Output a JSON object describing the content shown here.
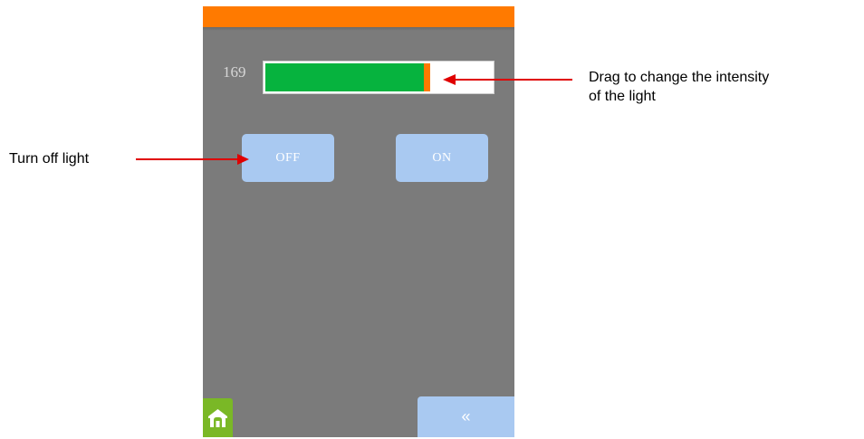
{
  "screen": {
    "colors": {
      "topbar": "#ff7a00",
      "background": "#7b7b7b",
      "slider_fill": "#06b33e",
      "slider_thumb": "#ff7a00",
      "button": "#a9c9f1",
      "home_button": "#7ab826"
    },
    "intensity": {
      "value_label": "169",
      "level_fraction": 0.7
    },
    "buttons": {
      "off_label": "OFF",
      "on_label": "ON",
      "back_label": "«",
      "home_icon": "home-icon",
      "back_icon": "double-chevron-left-icon"
    }
  },
  "annotations": {
    "drag_line1": "Drag to change the intensity",
    "drag_line2": "of the light",
    "turn_off": "Turn off light",
    "arrow_color": "#e00000"
  }
}
